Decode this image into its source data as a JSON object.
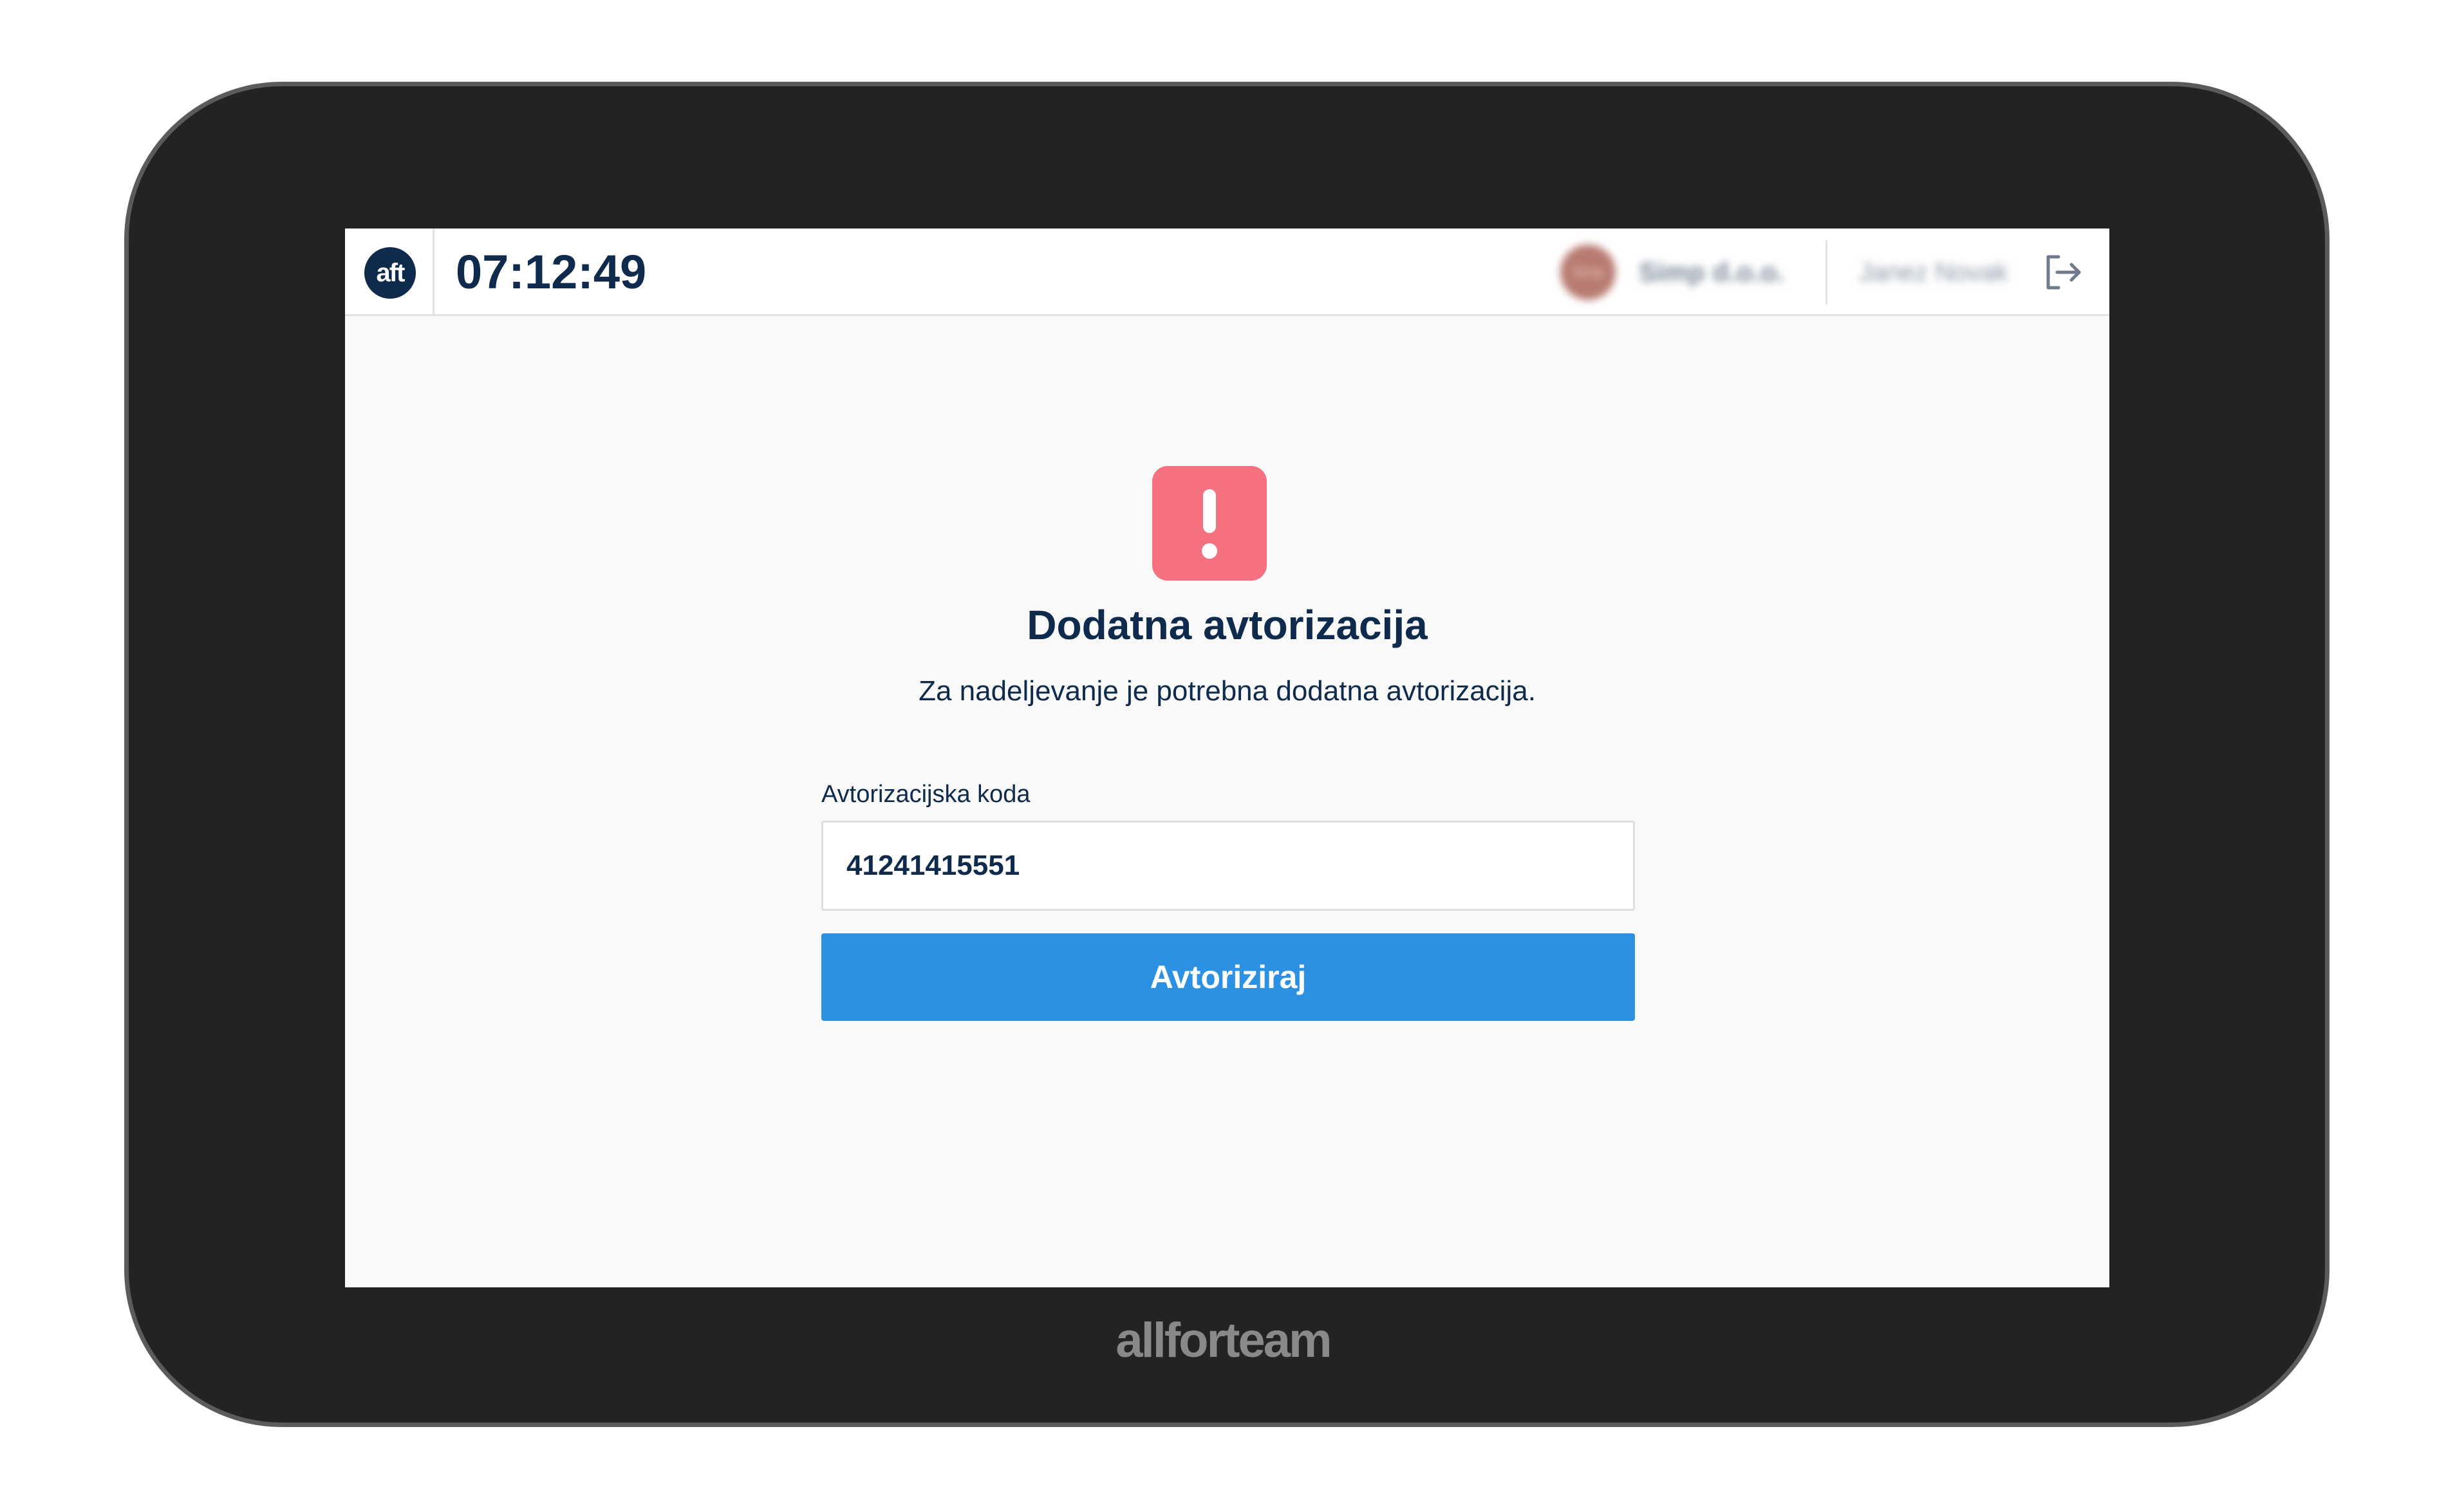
{
  "header": {
    "logo_text": "aft",
    "clock": "07:12:49",
    "company_avatar_text": "Simp",
    "company_name": "Simp d.o.o.",
    "user_name": "Janez Novak",
    "logout_icon": "logout-icon"
  },
  "main": {
    "alert_icon": "exclamation-icon",
    "title": "Dodatna avtorizacija",
    "subtitle": "Za nadeljevanje je potrebna dodatna avtorizacija.",
    "field_label": "Avtorizacijska koda",
    "code_value": "41241415551",
    "button_label": "Avtoriziraj"
  },
  "device": {
    "brand": "allforteam"
  },
  "colors": {
    "primary": "#2d91e3",
    "navy": "#0e2a4c",
    "alert": "#f6717f",
    "bezel": "#252223"
  }
}
